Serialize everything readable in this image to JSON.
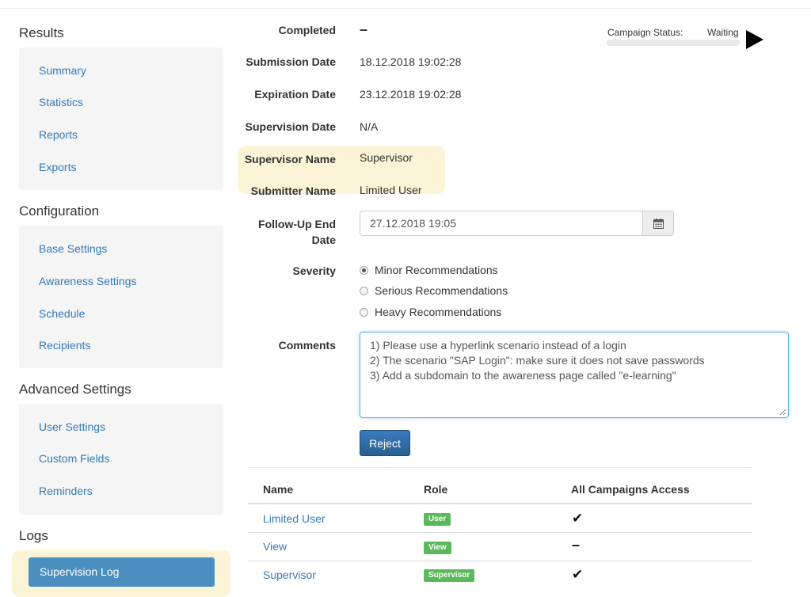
{
  "sidebar": {
    "results": {
      "title": "Results",
      "items": [
        "Summary",
        "Statistics",
        "Reports",
        "Exports"
      ]
    },
    "configuration": {
      "title": "Configuration",
      "items": [
        "Base Settings",
        "Awareness Settings",
        "Schedule",
        "Recipients"
      ]
    },
    "advanced": {
      "title": "Advanced Settings",
      "items": [
        "User Settings",
        "Custom Fields",
        "Reminders"
      ]
    },
    "logs": {
      "title": "Logs",
      "active_item": "Supervision Log"
    }
  },
  "campaign_status": {
    "label": "Campaign Status:",
    "value": "Waiting",
    "progress": 0
  },
  "form": {
    "completed": {
      "label": "Completed",
      "value": "–"
    },
    "submission_date": {
      "label": "Submission Date",
      "value": "18.12.2018 19:02:28"
    },
    "expiration_date": {
      "label": "Expiration Date",
      "value": "23.12.2018 19:02:28"
    },
    "supervision_date": {
      "label": "Supervision Date",
      "value": "N/A"
    },
    "supervisor_name": {
      "label": "Supervisor Name",
      "value": "Supervisor"
    },
    "submitter_name": {
      "label": "Submitter Name",
      "value": "Limited User"
    },
    "follow_up": {
      "label_line1": "Follow-Up End",
      "label_line2": "Date",
      "value": "27.12.2018 19:05"
    },
    "severity": {
      "label": "Severity",
      "options": [
        "Minor Recommendations",
        "Serious Recommendations",
        "Heavy Recommendations"
      ],
      "selected": "Minor Recommendations"
    },
    "comments": {
      "label": "Comments",
      "value": "1) Please use a hyperlink scenario instead of a login\n2) The scenario \"SAP Login\": make sure it does not save passwords\n3) Add a subdomain to the awareness page called \"e-learning\""
    },
    "reject_label": "Reject"
  },
  "table": {
    "headers": {
      "name": "Name",
      "role": "Role",
      "access": "All Campaigns Access"
    },
    "rows": [
      {
        "name": "Limited User",
        "role": "User",
        "access": "✔"
      },
      {
        "name": "View",
        "role": "View",
        "access": "–"
      },
      {
        "name": "Supervisor",
        "role": "Supervisor",
        "access": "✔"
      }
    ]
  },
  "colors": {
    "link": "#337ab7",
    "primary_button": "#286090",
    "badge": "#5cb85c",
    "highlight": "#fcf4d6"
  }
}
